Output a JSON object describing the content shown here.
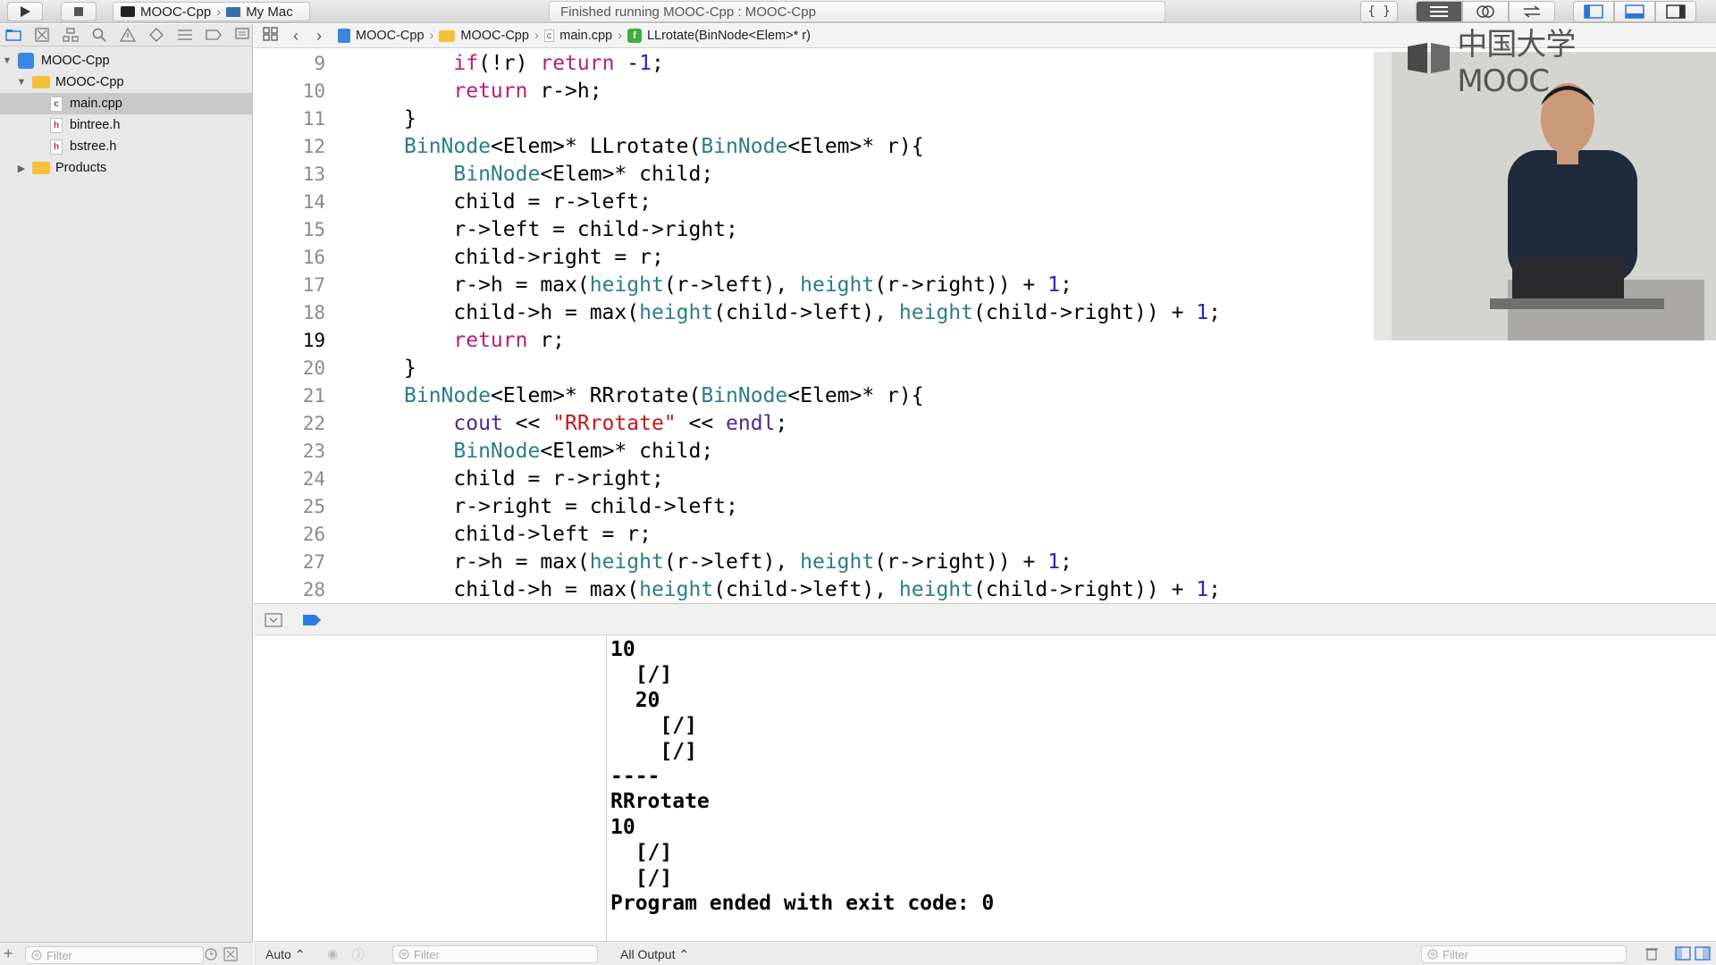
{
  "toolbar": {
    "scheme_target": "MOOC-Cpp",
    "scheme_device": "My Mac",
    "status_text": "Finished running MOOC-Cpp : MOOC-Cpp"
  },
  "navigator": {
    "items": [
      {
        "label": "MOOC-Cpp",
        "kind": "project",
        "depth": 0,
        "expanded": true
      },
      {
        "label": "MOOC-Cpp",
        "kind": "folder",
        "depth": 1,
        "expanded": true
      },
      {
        "label": "main.cpp",
        "kind": "cpp",
        "depth": 2,
        "selected": true
      },
      {
        "label": "bintree.h",
        "kind": "h",
        "depth": 2
      },
      {
        "label": "bstree.h",
        "kind": "h",
        "depth": 2
      },
      {
        "label": "Products",
        "kind": "folder",
        "depth": 1,
        "expanded": false
      }
    ],
    "filter_placeholder": "Filter"
  },
  "jumpbar": {
    "crumbs": [
      "MOOC-Cpp",
      "MOOC-Cpp",
      "main.cpp",
      "LLrotate(BinNode<Elem>* r)"
    ]
  },
  "editor": {
    "current_line": 19,
    "lines": [
      {
        "n": 9,
        "text": "        if(!r) return -1;"
      },
      {
        "n": 10,
        "text": "        return r->h;"
      },
      {
        "n": 11,
        "text": "    }"
      },
      {
        "n": 12,
        "text": "    BinNode<Elem>* LLrotate(BinNode<Elem>* r){"
      },
      {
        "n": 13,
        "text": "        BinNode<Elem>* child;"
      },
      {
        "n": 14,
        "text": "        child = r->left;"
      },
      {
        "n": 15,
        "text": "        r->left = child->right;"
      },
      {
        "n": 16,
        "text": "        child->right = r;"
      },
      {
        "n": 17,
        "text": "        r->h = max(height(r->left), height(r->right)) + 1;"
      },
      {
        "n": 18,
        "text": "        child->h = max(height(child->left), height(child->right)) + 1;"
      },
      {
        "n": 19,
        "text": "        return r;"
      },
      {
        "n": 20,
        "text": "    }"
      },
      {
        "n": 21,
        "text": "    BinNode<Elem>* RRrotate(BinNode<Elem>* r){"
      },
      {
        "n": 22,
        "text": "        cout << \"RRrotate\" << endl;"
      },
      {
        "n": 23,
        "text": "        BinNode<Elem>* child;"
      },
      {
        "n": 24,
        "text": "        child = r->right;"
      },
      {
        "n": 25,
        "text": "        r->right = child->left;"
      },
      {
        "n": 26,
        "text": "        child->left = r;"
      },
      {
        "n": 27,
        "text": "        r->h = max(height(r->left), height(r->right)) + 1;"
      },
      {
        "n": 28,
        "text": "        child->h = max(height(child->left), height(child->right)) + 1;"
      }
    ]
  },
  "console": {
    "lines": [
      "10",
      "  [/]",
      "  20",
      "    [/]",
      "    [/]",
      "----",
      "RRrotate",
      "10",
      "  [/]",
      "  [/]",
      "Program ended with exit code: 0"
    ]
  },
  "debug_footer": {
    "variables_mode": "Auto ⌃",
    "variables_filter": "Filter",
    "output_mode": "All Output ⌃",
    "console_filter": "Filter"
  },
  "video": {
    "logo_text": "中国大学MOOC"
  },
  "colors": {
    "keyword": "#b11f7a",
    "type": "#2b7d86",
    "number": "#2028c8",
    "string": "#c4171c"
  }
}
